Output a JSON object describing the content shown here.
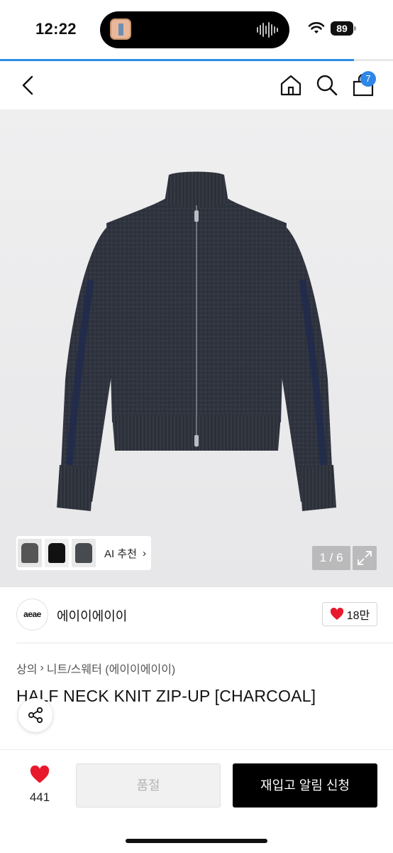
{
  "status_bar": {
    "time": "12:22",
    "battery": "89",
    "page_progress": 0.9
  },
  "nav": {
    "back_icon": "chevron-left-icon",
    "home_icon": "home-icon",
    "search_icon": "search-icon",
    "cart_icon": "shopping-bag-icon",
    "cart_count": "7"
  },
  "gallery": {
    "ai_recommend_label": "AI 추천",
    "counter": "1 / 6",
    "thumbnails": [
      "gray-knit",
      "black-knit",
      "charcoal-knit"
    ]
  },
  "brand": {
    "logo_text": "aeae",
    "name": "에이이에이이",
    "like_count": "18만"
  },
  "product": {
    "category": "상의",
    "subcategory": "니트/스웨터 (에이이에이이)",
    "title": "HALF NECK KNIT ZIP-UP [CHARCOAL]"
  },
  "bottom_bar": {
    "wish_count": "441",
    "soldout_label": "품절",
    "restock_label": "재입고 알림 신청"
  },
  "colors": {
    "accent_blue": "#2e87e8",
    "heart_red": "#e8192c",
    "sweater_charcoal": "#2f3340"
  }
}
